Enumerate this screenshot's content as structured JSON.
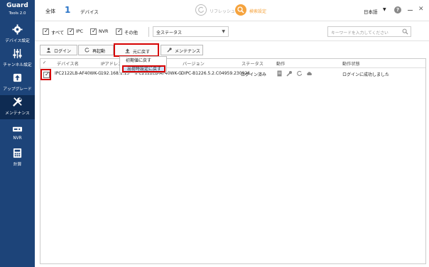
{
  "app": {
    "name": "Guard",
    "version": "Tools 2.0"
  },
  "sidebar": {
    "items": [
      {
        "label": "デバイス設定",
        "icon": "gear-icon"
      },
      {
        "label": "チャンネル設定",
        "icon": "sliders-icon"
      },
      {
        "label": "アップグレード",
        "icon": "upgrade-icon"
      },
      {
        "label": "メンテナンス",
        "icon": "tools-icon",
        "active": true
      },
      {
        "label": "NVR",
        "icon": "nvr-icon"
      },
      {
        "label": "計算",
        "icon": "calculator-icon"
      }
    ]
  },
  "topbar": {
    "all_label": "全体",
    "count": "1",
    "device_label": "デバイス",
    "refresh_label": "リフレッシュ",
    "search_settings_label": "検索設定",
    "language": "日本語"
  },
  "filters": {
    "checkboxes": [
      "すべて",
      "IPC",
      "NVR",
      "その他"
    ],
    "status_select": "全ステータス",
    "keyword_placeholder": "キーワードを入力してください"
  },
  "toolbar": {
    "login": "ログイン",
    "reboot": "再起動",
    "restore": "元に戻す",
    "maintenance": "メンテナンス"
  },
  "restore_menu": {
    "items": [
      "初期値に戻す",
      "出荷時設定に戻す"
    ],
    "highlighted": "出荷時設定に戻す"
  },
  "table": {
    "headers": [
      "デバイス名",
      "IPアドレス",
      "",
      "バージョン",
      "ステータス",
      "動作",
      "動作状態"
    ],
    "rows": [
      {
        "name": "IPC2122LB-AF40WK-G",
        "ip": "192.168.1.13",
        "model": "IPC2122LB-AF40WK-G",
        "version": "DIPC-B1226.5.2.C04959.230926",
        "status": "ログイン済み",
        "result": "ログインに成功しました",
        "checked": true
      }
    ]
  },
  "colors": {
    "sidebar": "#1d4479",
    "sidebar_active": "#0e2b52",
    "accent_blue": "#2a74c7",
    "accent_orange": "#f5a33e",
    "highlight_red": "#d60000"
  }
}
